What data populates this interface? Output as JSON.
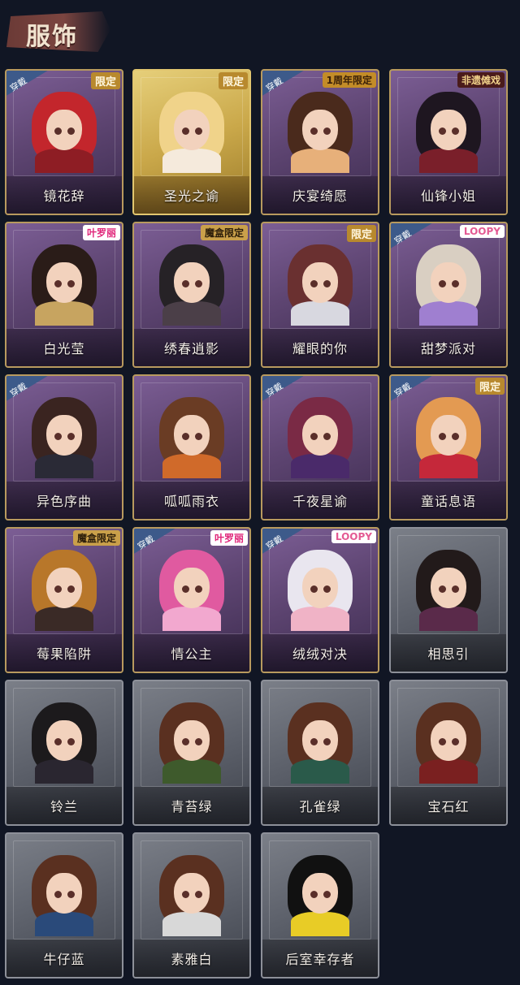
{
  "header": {
    "title": "服饰"
  },
  "wear_label": "穿戴",
  "costumes": [
    {
      "name": "镜花辞",
      "worn": true,
      "badge": "限定",
      "badge_type": "limited",
      "tone": "purple",
      "hair": "#c3262c",
      "outfit": "#8e1d24"
    },
    {
      "name": "圣光之谕",
      "worn": false,
      "badge": "限定",
      "badge_type": "limited",
      "tone": "gold",
      "hair": "#f0d38a",
      "outfit": "#f5eadc"
    },
    {
      "name": "庆宴绮愿",
      "worn": true,
      "badge": "1周年限定",
      "badge_type": "anniv",
      "tone": "purple",
      "hair": "#4a2a1c",
      "outfit": "#e7b07a"
    },
    {
      "name": "仙锋小姐",
      "worn": false,
      "badge": "非遗傩戏",
      "badge_type": "heritage",
      "tone": "purple",
      "hair": "#1e1620",
      "outfit": "#7a1f2a"
    },
    {
      "name": "白光莹",
      "worn": false,
      "badge": "叶罗丽",
      "badge_type": "collab",
      "tone": "purple",
      "hair": "#2a1c18",
      "outfit": "#c7a460"
    },
    {
      "name": "绣春逍影",
      "worn": false,
      "badge": "魔盒限定",
      "badge_type": "mystery",
      "tone": "purple",
      "hair": "#262226",
      "outfit": "#4b3f48"
    },
    {
      "name": "耀眼的你",
      "worn": false,
      "badge": "限定",
      "badge_type": "limited",
      "tone": "purple",
      "hair": "#6a3030",
      "outfit": "#d8d8e0"
    },
    {
      "name": "甜梦派对",
      "worn": true,
      "badge": "LOOPY",
      "badge_type": "loopy",
      "tone": "purple",
      "hair": "#d9cfc2",
      "outfit": "#9f7fd0"
    },
    {
      "name": "异色序曲",
      "worn": true,
      "badge": "",
      "badge_type": "",
      "tone": "purple",
      "hair": "#3a2420",
      "outfit": "#2a2a36"
    },
    {
      "name": "呱呱雨衣",
      "worn": false,
      "badge": "",
      "badge_type": "",
      "tone": "purple",
      "hair": "#6a3c24",
      "outfit": "#d06a2a"
    },
    {
      "name": "千夜星谕",
      "worn": true,
      "badge": "",
      "badge_type": "",
      "tone": "purple",
      "hair": "#7a2a45",
      "outfit": "#4a2a6a"
    },
    {
      "name": "童话息语",
      "worn": true,
      "badge": "限定",
      "badge_type": "limited",
      "tone": "purple",
      "hair": "#e39a52",
      "outfit": "#c5283a"
    },
    {
      "name": "莓果陷阱",
      "worn": false,
      "badge": "魔盒限定",
      "badge_type": "mystery",
      "tone": "purple",
      "hair": "#b8772a",
      "outfit": "#3a2a26"
    },
    {
      "name": "情公主",
      "worn": true,
      "badge": "叶罗丽",
      "badge_type": "collab",
      "tone": "purple",
      "hair": "#e05aa0",
      "outfit": "#f2a8cf"
    },
    {
      "name": "绒绒对决",
      "worn": true,
      "badge": "LOOPY",
      "badge_type": "loopy",
      "tone": "purple",
      "hair": "#e9e6ef",
      "outfit": "#f0b3c6"
    },
    {
      "name": "相思引",
      "worn": false,
      "badge": "",
      "badge_type": "",
      "tone": "gray",
      "hair": "#221a1a",
      "outfit": "#5a2a4a"
    },
    {
      "name": "铃兰",
      "worn": false,
      "badge": "",
      "badge_type": "",
      "tone": "gray",
      "hair": "#1c1a1c",
      "outfit": "#2a2630"
    },
    {
      "name": "青苔绿",
      "worn": false,
      "badge": "",
      "badge_type": "",
      "tone": "gray",
      "hair": "#5a3020",
      "outfit": "#3e5a2c"
    },
    {
      "name": "孔雀绿",
      "worn": false,
      "badge": "",
      "badge_type": "",
      "tone": "gray",
      "hair": "#5a3020",
      "outfit": "#2a5a4a"
    },
    {
      "name": "宝石红",
      "worn": false,
      "badge": "",
      "badge_type": "",
      "tone": "gray",
      "hair": "#5a3020",
      "outfit": "#7a2020"
    },
    {
      "name": "牛仔蓝",
      "worn": false,
      "badge": "",
      "badge_type": "",
      "tone": "gray",
      "hair": "#5a3020",
      "outfit": "#2a4a7a"
    },
    {
      "name": "素雅白",
      "worn": false,
      "badge": "",
      "badge_type": "",
      "tone": "gray",
      "hair": "#5a3020",
      "outfit": "#d8d8d8"
    },
    {
      "name": "后室幸存者",
      "worn": false,
      "badge": "",
      "badge_type": "",
      "tone": "gray",
      "hair": "#111111",
      "outfit": "#e8cc26"
    }
  ]
}
